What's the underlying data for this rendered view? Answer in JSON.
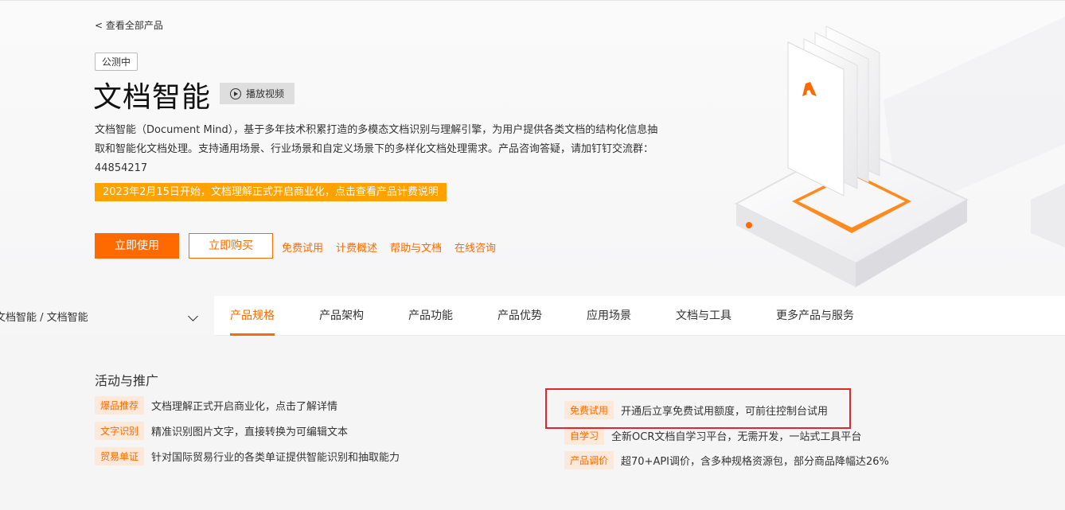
{
  "hero": {
    "back_link": "< 查看全部产品",
    "beta_badge": "公测中",
    "title": "文档智能",
    "video_button": "播放视频",
    "description": "文档智能（Document Mind），基于多年技术积累打造的多模态文档识别与理解引擎，为用户提供各类文档的结构化信息抽取和智能化文档处理。支持通用场景、行业场景和自定义场景下的多样化文档处理需求。产品咨询答疑，请加钉钉交流群：44854217",
    "notice": "2023年2月15日开始，文档理解正式开启商业化，点击查看产品计费说明",
    "primary_button": "立即使用",
    "buy_button": "立即购买",
    "links": [
      "免费试用",
      "计费概述",
      "帮助与文档",
      "在线咨询"
    ]
  },
  "nav": {
    "breadcrumb": "文档智能 / 文档智能",
    "tabs": [
      "产品规格",
      "产品架构",
      "产品功能",
      "产品优势",
      "应用场景",
      "文档与工具",
      "更多产品与服务"
    ],
    "active_tab": "产品规格"
  },
  "promotions": {
    "title": "活动与推广",
    "left": [
      {
        "tag": "爆品推荐",
        "text": "文档理解正式开启商业化，点击了解详情"
      },
      {
        "tag": "文字识别",
        "text": "精准识别图片文字，直接转换为可编辑文本"
      },
      {
        "tag": "贸易单证",
        "text": "针对国际贸易行业的各类单证提供智能识别和抽取能力"
      }
    ],
    "right": [
      {
        "tag": "免费试用",
        "text": "开通后立享免费试用额度，可前往控制台试用"
      },
      {
        "tag": "自学习",
        "text": "全新OCR文档自学习平台，无需开发，一站式工具平台"
      },
      {
        "tag": "产品调价",
        "text": "超70+API调价，含多种规格资源包，部分商品降幅达26%"
      }
    ]
  },
  "colors": {
    "accent": "#ff6a00",
    "notice": "#ffa200",
    "highlight": "#e3262d"
  },
  "icons": [
    "play-icon",
    "chevron-down-icon",
    "document-illustration"
  ]
}
